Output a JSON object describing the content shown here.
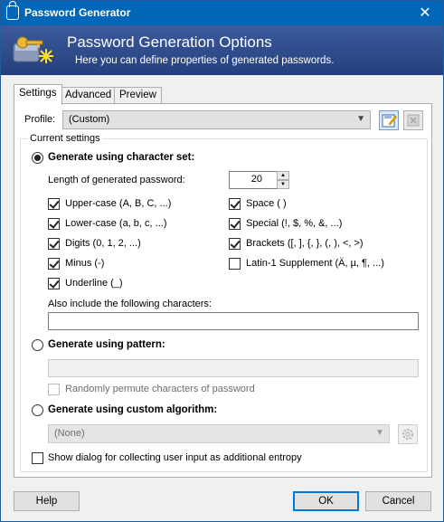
{
  "window": {
    "title": "Password Generator",
    "close_glyph": "✕",
    "icon": "lock-icon"
  },
  "header": {
    "title": "Password Generation Options",
    "subtitle": "Here you can define properties of generated passwords.",
    "icon": "keys-icon"
  },
  "tabs": [
    {
      "label": "Settings",
      "active": true
    },
    {
      "label": "Advanced",
      "active": false
    },
    {
      "label": "Preview",
      "active": false
    }
  ],
  "profile": {
    "label": "Profile:",
    "value": "(Custom)",
    "save_icon": "save-profile-icon",
    "delete_icon": "delete-profile-icon"
  },
  "current_settings": {
    "legend": "Current settings"
  },
  "charset": {
    "radio_label": "Generate using character set:",
    "selected": true,
    "length_label": "Length of generated password:",
    "length_value": "20",
    "options_left": [
      {
        "label": "Upper-case (A, B, C, ...)",
        "checked": true
      },
      {
        "label": "Lower-case (a, b, c, ...)",
        "checked": true
      },
      {
        "label": "Digits (0, 1, 2, ...)",
        "checked": true
      },
      {
        "label": "Minus (-)",
        "checked": true
      },
      {
        "label": "Underline (_)",
        "checked": true
      }
    ],
    "options_right": [
      {
        "label": "Space ( )",
        "checked": true
      },
      {
        "label": "Special (!, $, %, &, ...)",
        "checked": true
      },
      {
        "label": "Brackets ([, ], {, }, (, ), <, >)",
        "checked": true
      },
      {
        "label": "Latin-1 Supplement (Ä, µ, ¶, ...)",
        "checked": false
      }
    ],
    "also_include_label": "Also include the following characters:",
    "also_include_value": ""
  },
  "pattern": {
    "radio_label": "Generate using pattern:",
    "selected": false,
    "value": "",
    "permute_label": "Randomly permute characters of password",
    "permute_checked": false
  },
  "custom_algorithm": {
    "radio_label": "Generate using custom algorithm:",
    "selected": false,
    "value": "(None)"
  },
  "entropy": {
    "label": "Show dialog for collecting user input as additional entropy",
    "checked": false
  },
  "buttons": {
    "help": "Help",
    "ok": "OK",
    "cancel": "Cancel"
  },
  "colors": {
    "titlebar": "#0067b8",
    "banner": "#2c4a8a",
    "accent": "#0078d7"
  }
}
